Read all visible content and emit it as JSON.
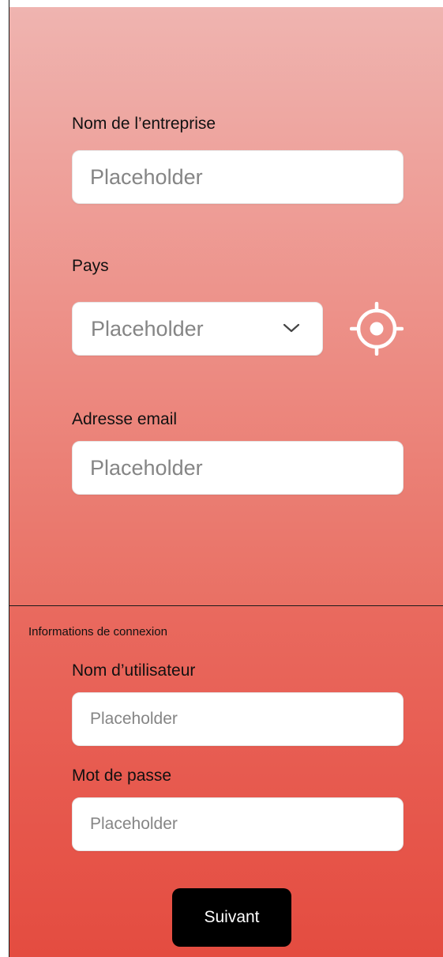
{
  "company": {
    "label": "Nom de l’entreprise",
    "placeholder": "Placeholder"
  },
  "country": {
    "label": "Pays",
    "placeholder": "Placeholder",
    "chevron_icon": "chevron-down-icon",
    "locate_icon": "crosshair-locate-icon"
  },
  "email": {
    "label": "Adresse email",
    "placeholder": "Placeholder"
  },
  "login": {
    "section_title": "Informations de connexion",
    "username": {
      "label": "Nom d’utilisateur",
      "placeholder": "Placeholder"
    },
    "password": {
      "label": "Mot de passe",
      "placeholder": "Placeholder"
    }
  },
  "actions": {
    "next_label": "Suivant"
  },
  "colors": {
    "gradient_top": "#efb4b0",
    "gradient_bottom": "#e44c40",
    "button": "#000000",
    "field_background": "#ffffff",
    "placeholder_text": "#858585"
  }
}
